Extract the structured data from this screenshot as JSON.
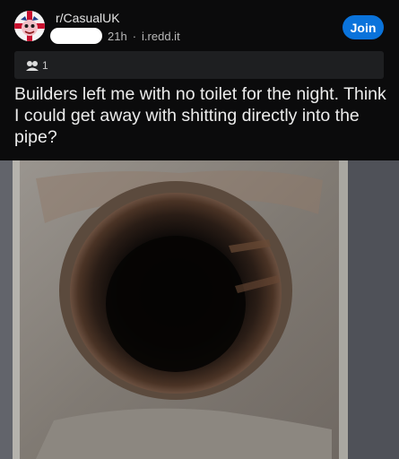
{
  "post": {
    "subreddit": "r/CasualUK",
    "age": "21h",
    "separator": "·",
    "domain": "i.redd.it",
    "join_label": "Join",
    "award_count": "1",
    "title": "Builders left me with no toilet for the night. Think I could get away with shitting directly into the pipe?"
  },
  "colors": {
    "background": "#0b0b0c",
    "join_button": "#0a73db",
    "award_bar": "#1e1f21"
  },
  "icons": {
    "avatar": "subreddit-avatar-icon",
    "award": "award-icon"
  }
}
